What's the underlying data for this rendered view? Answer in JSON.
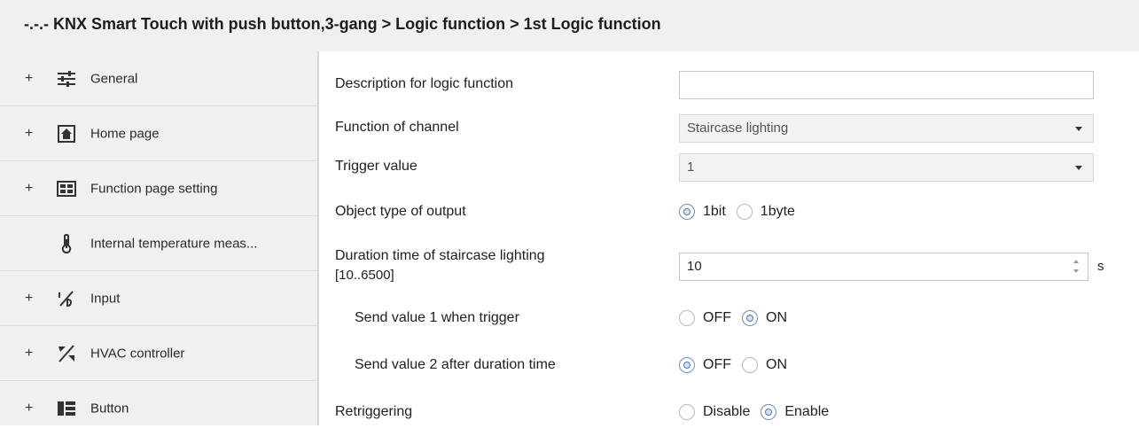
{
  "title": "-.-.- KNX Smart Touch with push button,3-gang > Logic function > 1st Logic function",
  "sidebar": {
    "items": [
      {
        "label": "General",
        "icon": "sliders-icon",
        "expand": "+"
      },
      {
        "label": "Home page",
        "icon": "home-icon",
        "expand": "+"
      },
      {
        "label": "Function page setting",
        "icon": "grid-icon",
        "expand": "+"
      },
      {
        "label": "Internal temperature meas...",
        "icon": "thermometer-icon",
        "expand": ""
      },
      {
        "label": "Input",
        "icon": "input-icon",
        "expand": "+"
      },
      {
        "label": "HVAC controller",
        "icon": "hvac-icon",
        "expand": "+"
      },
      {
        "label": "Button",
        "icon": "button-icon",
        "expand": "+"
      }
    ]
  },
  "params": {
    "description": {
      "label": "Description for logic function",
      "value": ""
    },
    "function_of_channel": {
      "label": "Function of channel",
      "value": "Staircase lighting"
    },
    "trigger_value": {
      "label": "Trigger value",
      "value": "1"
    },
    "object_type": {
      "label": "Object type of  output",
      "options": [
        "1bit",
        "1byte"
      ],
      "selected": "1bit"
    },
    "duration": {
      "label_line1": "Duration time of staircase lighting",
      "label_line2": "[10..6500]",
      "value": "10",
      "unit": "s"
    },
    "send_value_1": {
      "label": "Send value 1 when trigger",
      "options": [
        "OFF",
        "ON"
      ],
      "selected": "ON"
    },
    "send_value_2": {
      "label": "Send value 2 after duration time",
      "options": [
        "OFF",
        "ON"
      ],
      "selected": "OFF"
    },
    "retriggering": {
      "label": "Retriggering",
      "options": [
        "Disable",
        "Enable"
      ],
      "selected": "Enable"
    }
  }
}
